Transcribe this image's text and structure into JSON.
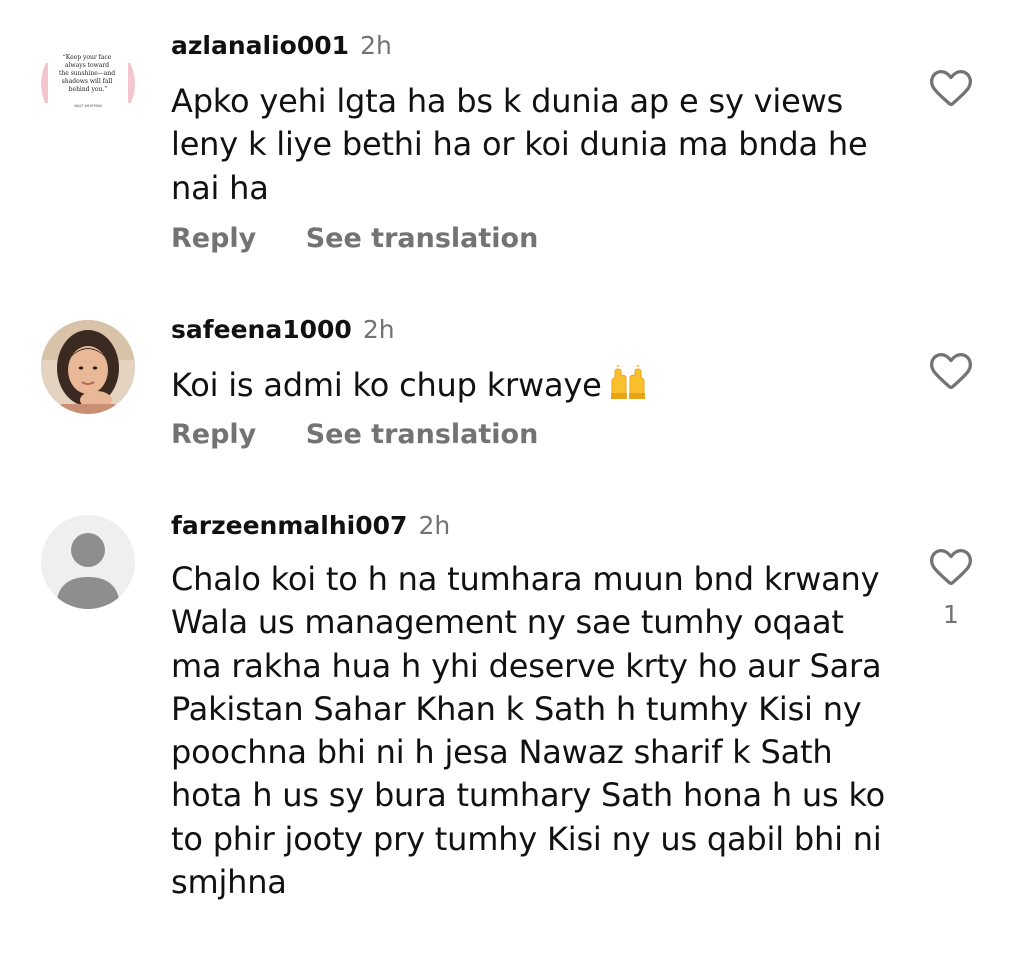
{
  "comments": [
    {
      "username": "azlanalio001",
      "time": "2h",
      "text": "Apko yehi lgta ha bs k dunia ap e sy views leny k liye bethi ha or koi dunia ma bnda he nai ha",
      "avatar_quote": "“Keep your face always toward the sunshine—and shadows will fall behind you.”",
      "avatar_author": "WALT WHITMAN",
      "reply_label": "Reply",
      "translate_label": "See translation",
      "like_count": ""
    },
    {
      "username": "safeena1000",
      "time": "2h",
      "text": "Koi is admi ko chup krwaye",
      "emoji": "raising-hands",
      "reply_label": "Reply",
      "translate_label": "See translation",
      "like_count": ""
    },
    {
      "username": "farzeenmalhi007",
      "time": "2h",
      "text": "Chalo koi to h na tumhara muun bnd krwany Wala us management ny sae tumhy oqaat ma rakha hua h yhi deserve krty ho aur Sara Pakistan Sahar Khan k Sath h tumhy Kisi ny poochna bhi ni h jesa Nawaz sharif k Sath hota h us sy bura tumhary Sath hona h us ko to phir jooty pry tumhy Kisi ny us qabil bhi ni smjhna",
      "like_count": "1"
    }
  ],
  "icons": {
    "like": "heart-outline-icon",
    "default_avatar": "person-silhouette-icon"
  },
  "colors": {
    "primary_text": "#111111",
    "secondary_text": "#737373",
    "background": "#ffffff"
  }
}
